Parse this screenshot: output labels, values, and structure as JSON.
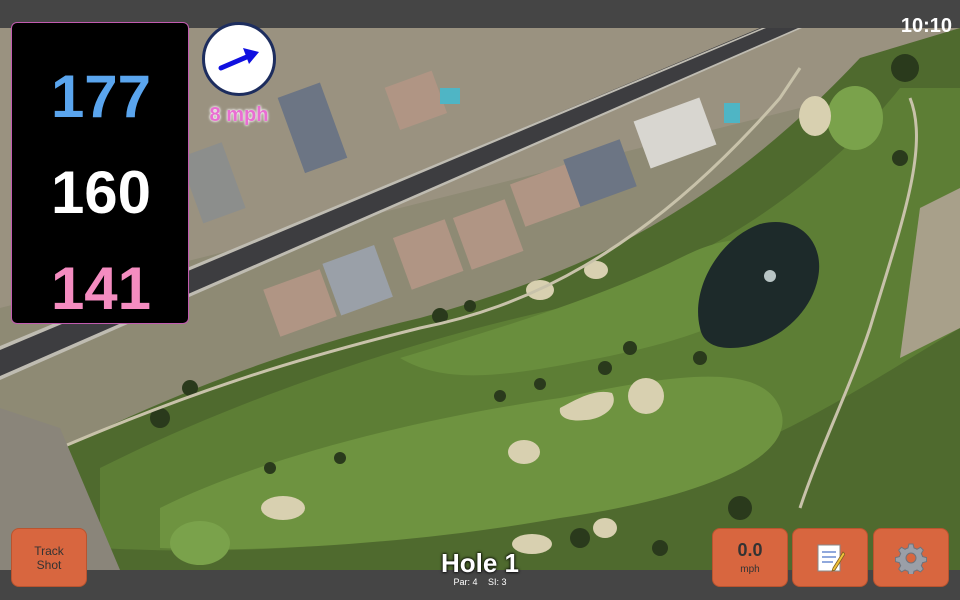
{
  "status": {
    "time": "10:10"
  },
  "distances": {
    "back": "177",
    "middle": "160",
    "front": "141"
  },
  "wind": {
    "speed_label": "8 mph",
    "icon": "arrow-up-right-icon"
  },
  "hole": {
    "title": "Hole 1",
    "par_label": "Par: 4",
    "si_label": "SI: 3"
  },
  "controls": {
    "track_shot_line1": "Track",
    "track_shot_line2": "Shot",
    "speed_value": "0.0",
    "speed_unit": "mph",
    "notes_icon": "notepad-icon",
    "settings_icon": "gear-icon"
  },
  "colors": {
    "back_distance": "#5aa5ee",
    "middle_distance": "#ffffff",
    "front_distance": "#f48cc0",
    "button": "#d8663f",
    "wind_text": "#e96ed2"
  }
}
